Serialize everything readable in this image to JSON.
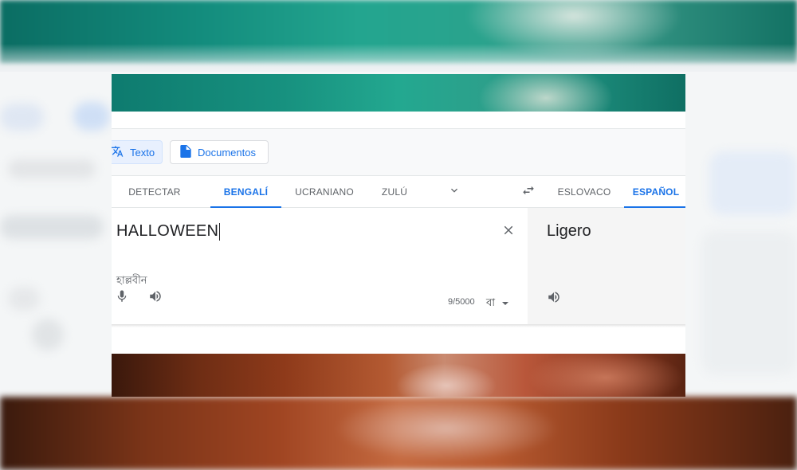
{
  "modes": {
    "text_label": "Texto",
    "documents_label": "Documentos"
  },
  "source_languages": [
    {
      "label": "DETECTAR IDIOMA",
      "active": false
    },
    {
      "label": "BENGALÍ",
      "active": true
    },
    {
      "label": "UCRANIANO",
      "active": false
    },
    {
      "label": "ZULÚ",
      "active": false
    }
  ],
  "target_languages": [
    {
      "label": "ESLOVACO",
      "active": false
    },
    {
      "label": "ESPAÑOL",
      "active": true
    }
  ],
  "source": {
    "text": "HALLOWEEN",
    "transliteration": "হাল্লবীন",
    "char_count": "9/5000",
    "keyboard_label": "বা"
  },
  "target": {
    "text": "Ligero"
  },
  "icons": {
    "text_mode": "translate-icon",
    "documents_mode": "document-icon",
    "more_languages": "chevron-down-icon",
    "swap": "swap-icon",
    "clear": "close-icon",
    "mic": "mic-icon",
    "listen": "speaker-icon",
    "keyboard_dropdown": "caret-down-icon"
  },
  "colors": {
    "accent": "#1a73e8",
    "text_primary": "#202124",
    "text_secondary": "#5f6368"
  }
}
